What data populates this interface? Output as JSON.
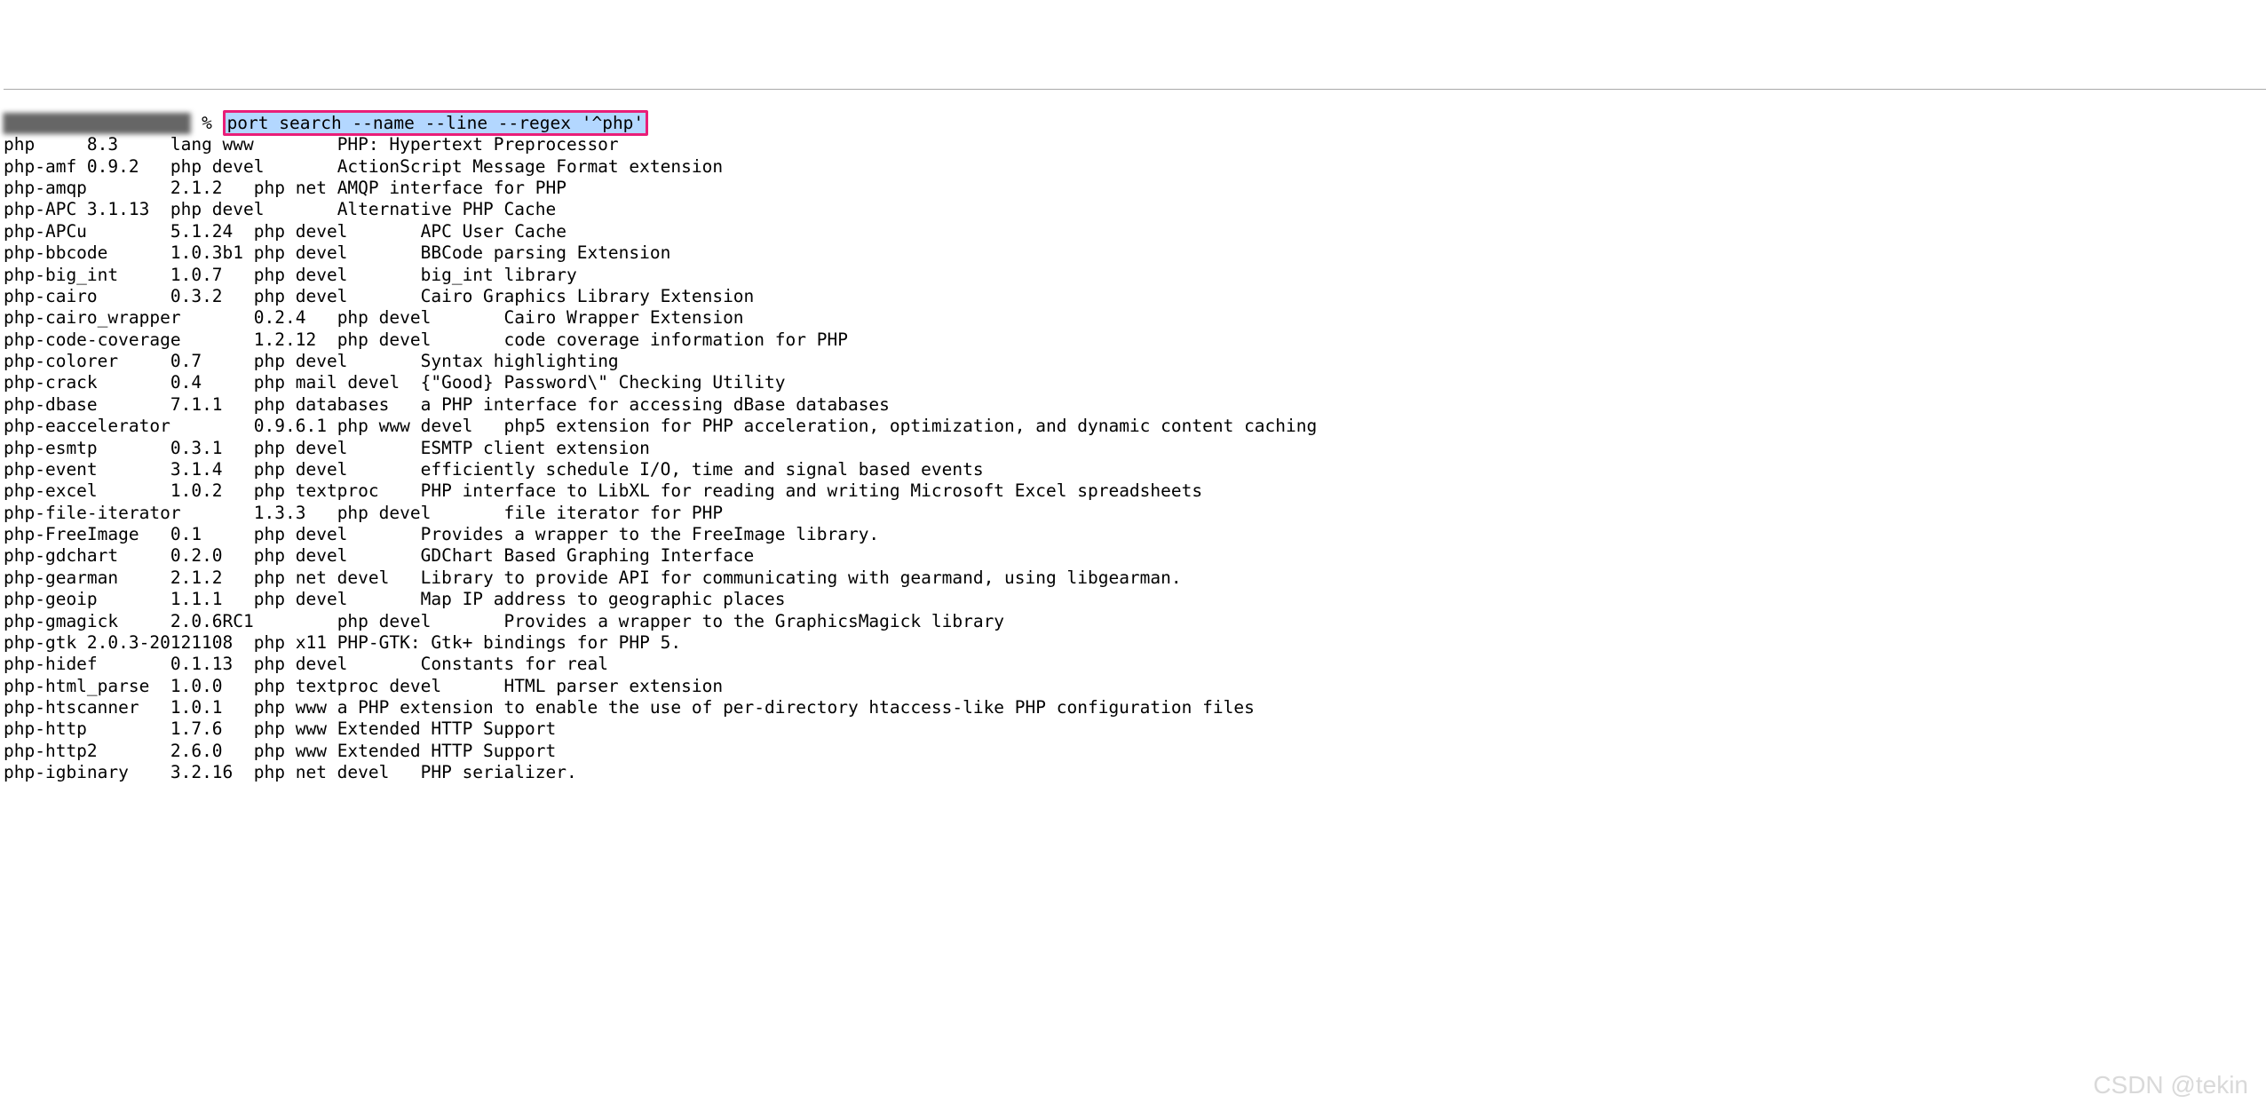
{
  "prompt": {
    "redacted_prefix": "t▓▓▓▓▓▓▓▓▓▓▓▓▓▓▓▓▓",
    "symbol": " % ",
    "command": "port search --name --line --regex '^php'"
  },
  "packages": [
    {
      "name": "php",
      "version": "8.3",
      "categories": "lang www",
      "desc": "PHP: Hypertext Preprocessor"
    },
    {
      "name": "php-amf",
      "version": "0.9.2",
      "categories": "php devel",
      "desc": "ActionScript Message Format extension"
    },
    {
      "name": "php-amqp",
      "version": "2.1.2",
      "categories": "php net",
      "desc": "AMQP interface for PHP"
    },
    {
      "name": "php-APC",
      "version": "3.1.13",
      "categories": "php devel",
      "desc": "Alternative PHP Cache"
    },
    {
      "name": "php-APCu",
      "version": "5.1.24",
      "categories": "php devel",
      "desc": "APC User Cache"
    },
    {
      "name": "php-bbcode",
      "version": "1.0.3b1",
      "categories": "php devel",
      "desc": "BBCode parsing Extension"
    },
    {
      "name": "php-big_int",
      "version": "1.0.7",
      "categories": "php devel",
      "desc": "big_int library"
    },
    {
      "name": "php-cairo",
      "version": "0.3.2",
      "categories": "php devel",
      "desc": "Cairo Graphics Library Extension"
    },
    {
      "name": "php-cairo_wrapper",
      "version": "0.2.4",
      "categories": "php devel",
      "desc": "Cairo Wrapper Extension"
    },
    {
      "name": "php-code-coverage",
      "version": "1.2.12",
      "categories": "php devel",
      "desc": "code coverage information for PHP"
    },
    {
      "name": "php-colorer",
      "version": "0.7",
      "categories": "php devel",
      "desc": "Syntax highlighting"
    },
    {
      "name": "php-crack",
      "version": "0.4",
      "categories": "php mail devel",
      "desc": "{\"Good} Password\\\" Checking Utility"
    },
    {
      "name": "php-dbase",
      "version": "7.1.1",
      "categories": "php databases",
      "desc": "a PHP interface for accessing dBase databases"
    },
    {
      "name": "php-eaccelerator",
      "version": "0.9.6.1",
      "categories": "php www devel",
      "desc": "php5 extension for PHP acceleration, optimization, and dynamic content caching"
    },
    {
      "name": "php-esmtp",
      "version": "0.3.1",
      "categories": "php devel",
      "desc": "ESMTP client extension"
    },
    {
      "name": "php-event",
      "version": "3.1.4",
      "categories": "php devel",
      "desc": "efficiently schedule I/O, time and signal based events"
    },
    {
      "name": "php-excel",
      "version": "1.0.2",
      "categories": "php textproc",
      "desc": "PHP interface to LibXL for reading and writing Microsoft Excel spreadsheets"
    },
    {
      "name": "php-file-iterator",
      "version": "1.3.3",
      "categories": "php devel",
      "desc": "file iterator for PHP"
    },
    {
      "name": "php-FreeImage",
      "version": "0.1",
      "categories": "php devel",
      "desc": "Provides a wrapper to the FreeImage library."
    },
    {
      "name": "php-gdchart",
      "version": "0.2.0",
      "categories": "php devel",
      "desc": "GDChart Based Graphing Interface"
    },
    {
      "name": "php-gearman",
      "version": "2.1.2",
      "categories": "php net devel",
      "desc": "Library to provide API for communicating with gearmand, using libgearman."
    },
    {
      "name": "php-geoip",
      "version": "1.1.1",
      "categories": "php devel",
      "desc": "Map IP address to geographic places"
    },
    {
      "name": "php-gmagick",
      "version": "2.0.6RC1",
      "categories": "php devel",
      "desc": "Provides a wrapper to the GraphicsMagick library"
    },
    {
      "name": "php-gtk",
      "version": "2.0.3-20121108",
      "categories": "php x11",
      "desc": "PHP-GTK: Gtk+ bindings for PHP 5."
    },
    {
      "name": "php-hidef",
      "version": "0.1.13",
      "categories": "php devel",
      "desc": "Constants for real"
    },
    {
      "name": "php-html_parse",
      "version": "1.0.0",
      "categories": "php textproc devel",
      "desc": "HTML parser extension"
    },
    {
      "name": "php-htscanner",
      "version": "1.0.1",
      "categories": "php www",
      "desc": "a PHP extension to enable the use of per-directory htaccess-like PHP configuration files"
    },
    {
      "name": "php-http",
      "version": "1.7.6",
      "categories": "php www",
      "desc": "Extended HTTP Support"
    },
    {
      "name": "php-http2",
      "version": "2.6.0",
      "categories": "php www",
      "desc": "Extended HTTP Support"
    },
    {
      "name": "php-igbinary",
      "version": "3.2.16",
      "categories": "php net devel",
      "desc": "PHP serializer."
    }
  ],
  "watermark": "CSDN @tekin"
}
